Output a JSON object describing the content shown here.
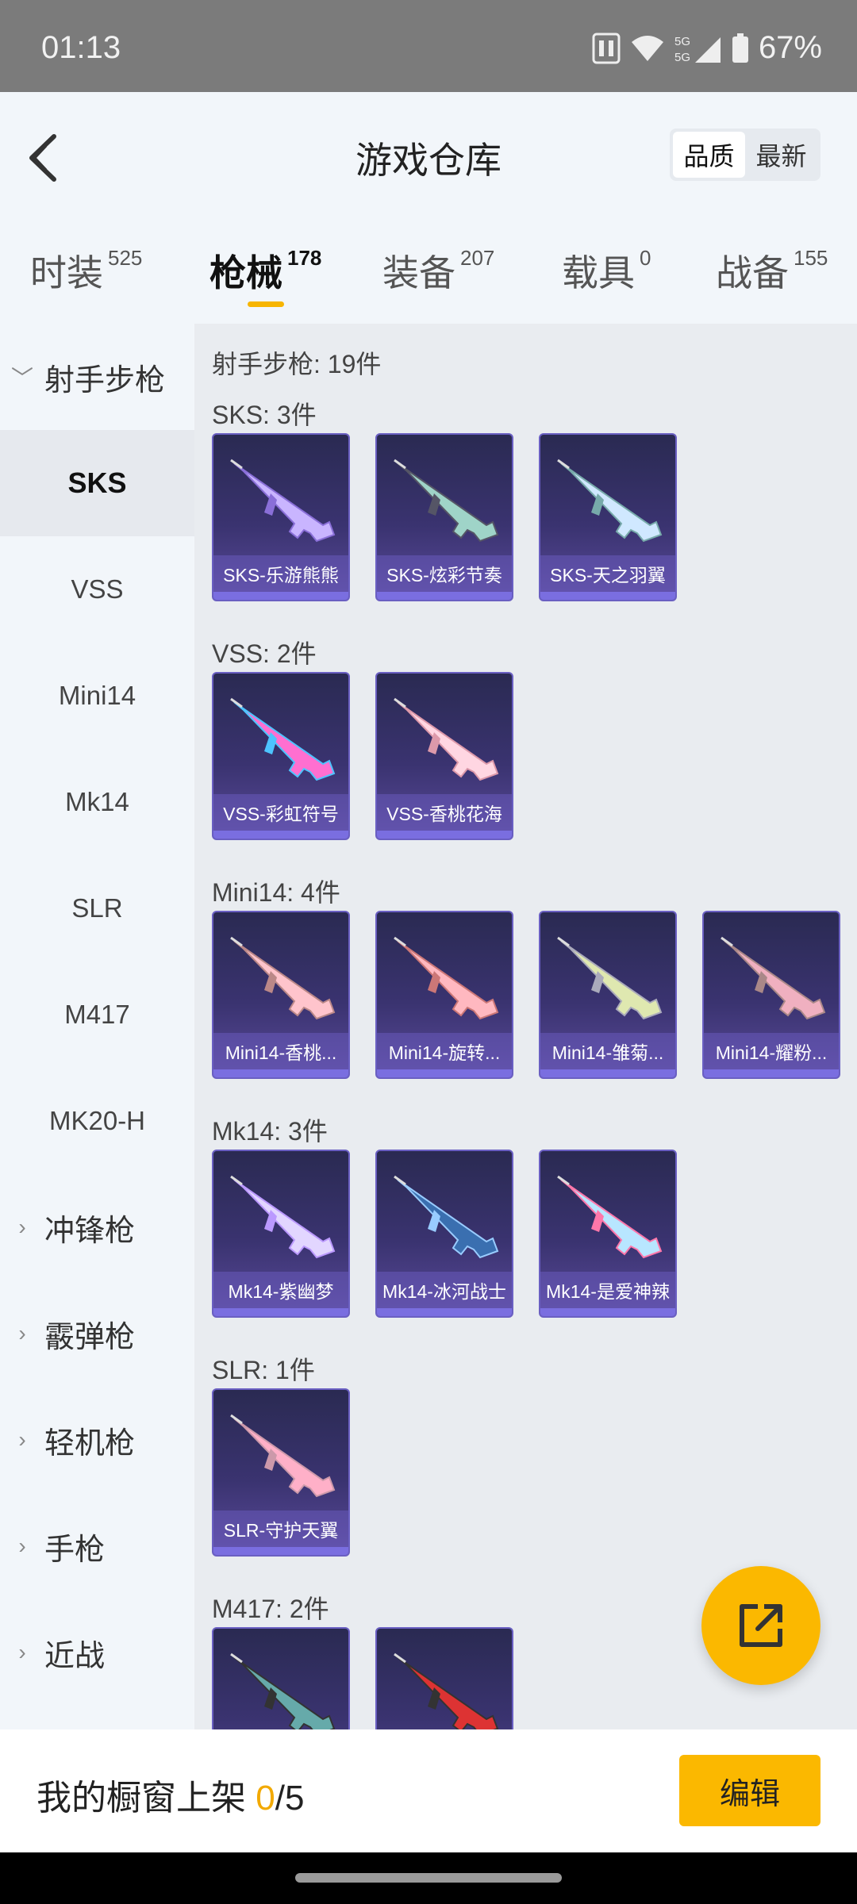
{
  "status": {
    "time": "01:13",
    "network": "5G",
    "battery": "67%"
  },
  "header": {
    "title": "游戏仓库",
    "sort_options": [
      "品质",
      "最新"
    ],
    "sort_active": "品质"
  },
  "tabs": [
    {
      "label": "时装",
      "count": "525"
    },
    {
      "label": "枪械",
      "count": "178",
      "active": true
    },
    {
      "label": "装备",
      "count": "207"
    },
    {
      "label": "载具",
      "count": "0"
    },
    {
      "label": "战备",
      "count": "155"
    }
  ],
  "sidebar": {
    "open_category": "射手步枪",
    "sub_items": [
      "SKS",
      "VSS",
      "Mini14",
      "Mk14",
      "SLR",
      "M417",
      "MK20-H"
    ],
    "active_sub": "SKS",
    "categories": [
      "冲锋枪",
      "霰弹枪",
      "轻机枪",
      "手枪",
      "近战"
    ]
  },
  "main": {
    "summary": "射手步枪: 19件",
    "sections": [
      {
        "title": "SKS: 3件",
        "items": [
          "SKS-乐游熊熊",
          "SKS-炫彩节奏",
          "SKS-天之羽翼"
        ]
      },
      {
        "title": "VSS: 2件",
        "items": [
          "VSS-彩虹符号",
          "VSS-香桃花海"
        ]
      },
      {
        "title": "Mini14: 4件",
        "items": [
          "Mini14-香桃...",
          "Mini14-旋转...",
          "Mini14-雏菊...",
          "Mini14-耀粉..."
        ]
      },
      {
        "title": "Mk14: 3件",
        "items": [
          "Mk14-紫幽梦",
          "Mk14-冰河战士",
          "Mk14-是爱神辣"
        ]
      },
      {
        "title": "SLR: 1件",
        "items": [
          "SLR-守护天翼"
        ]
      },
      {
        "title": "M417: 2件",
        "items": [
          "",
          ""
        ]
      }
    ]
  },
  "bottom": {
    "label_prefix": "我的橱窗上架 ",
    "current": "0",
    "total": "/5",
    "edit_label": "编辑"
  },
  "colors": {
    "accent": "#fbb800",
    "card_border": "#6a5fc2"
  },
  "icons": {
    "back": "chevron-left-icon",
    "share": "share-external-icon"
  }
}
